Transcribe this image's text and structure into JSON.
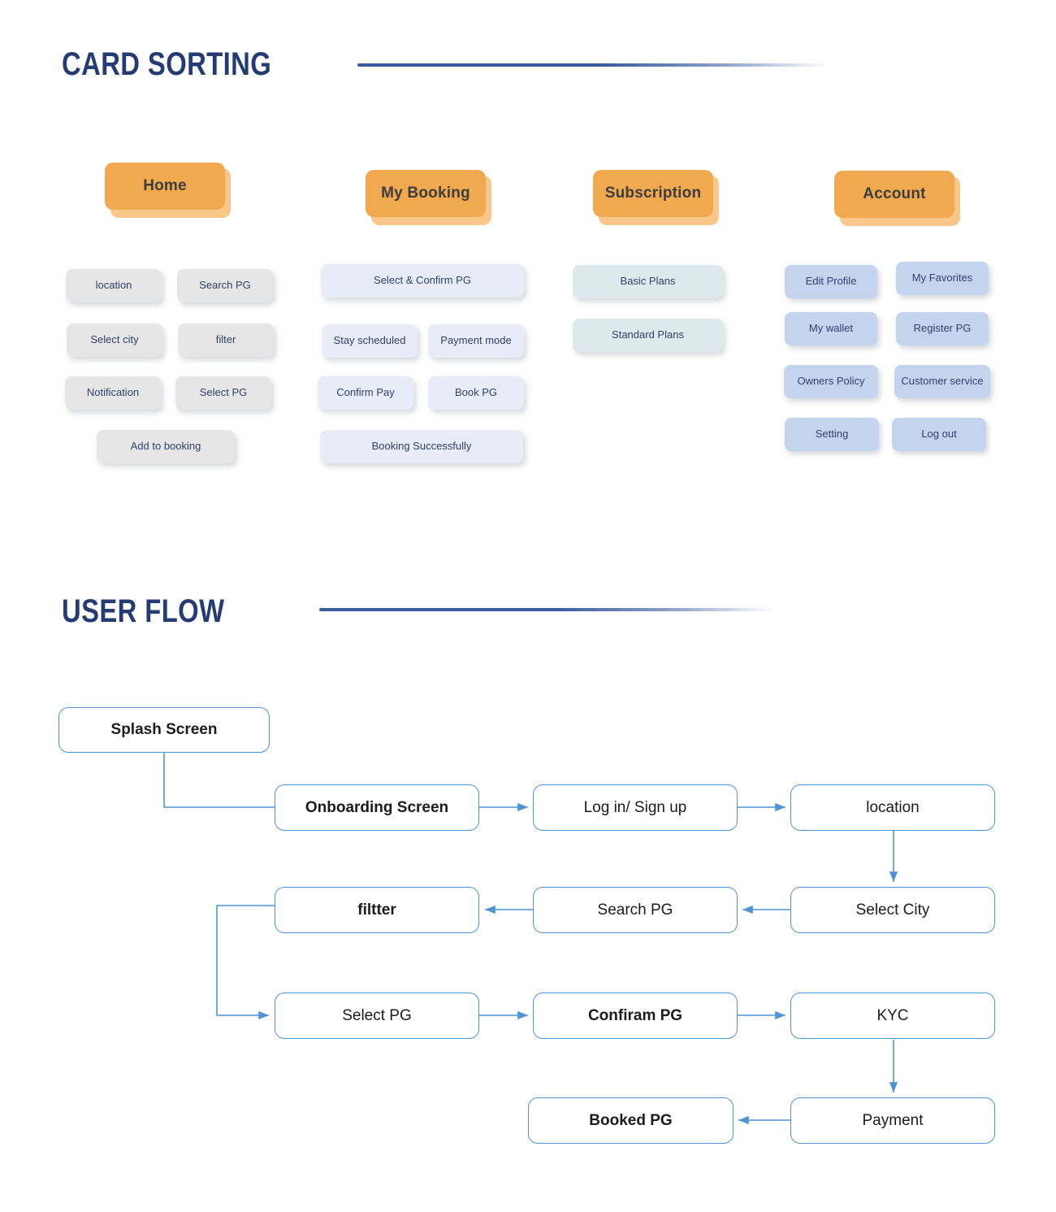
{
  "theme": {
    "heading_color": "#253b73",
    "rule_color": "#3a5c9e",
    "header_card_color": "#f0a94f",
    "header_card_base_color": "#f8c789",
    "card_gray": "#e6e6e6",
    "card_blue_light": "#e7ecf7",
    "card_teal": "#dde9ec",
    "card_blue": "#c4d4ee",
    "flow_border_color": "#4d94d6",
    "flow_text_color": "#1c1c1c",
    "card_text_color": "#32406b"
  },
  "sections": {
    "card_sorting": {
      "title": "CARD SORTING",
      "columns": [
        {
          "header": "Home",
          "card_style": "gray",
          "cards": [
            "location",
            "Search PG",
            "Select city",
            "filter",
            "Notification",
            "Select PG",
            "Add to booking"
          ]
        },
        {
          "header": "My Booking",
          "card_style": "blue1",
          "cards": [
            "Select & Confirm PG",
            "Stay scheduled",
            "Payment mode",
            "Confirm Pay",
            "Book PG",
            "Booking Successfully"
          ]
        },
        {
          "header": "Subscription",
          "card_style": "teal",
          "cards": [
            "Basic Plans",
            "Standard Plans"
          ]
        },
        {
          "header": "Account",
          "card_style": "blue2",
          "cards": [
            "Edit Profile",
            "My Favorites",
            "My wallet",
            "Register PG",
            "Owners Policy",
            "Customer service",
            "Setting",
            "Log out"
          ]
        }
      ]
    },
    "user_flow": {
      "title": "USER FLOW",
      "nodes": [
        "Splash Screen",
        "Onboarding Screen",
        "Log in/ Sign up",
        "location",
        "filtter",
        "Search PG",
        "Select City",
        "Select PG",
        "Confiram PG",
        "KYC",
        "Booked PG",
        "Payment"
      ],
      "edges": [
        "Splash Screen -> Onboarding Screen",
        "Onboarding Screen -> Log in/ Sign up",
        "Log in/ Sign up -> location",
        "location -> Select City",
        "Select City -> Search PG",
        "Search PG -> filtter",
        "filtter -> Select PG",
        "Select PG -> Confiram PG",
        "Confiram PG -> KYC",
        "KYC -> Payment",
        "Payment -> Booked PG"
      ]
    }
  }
}
